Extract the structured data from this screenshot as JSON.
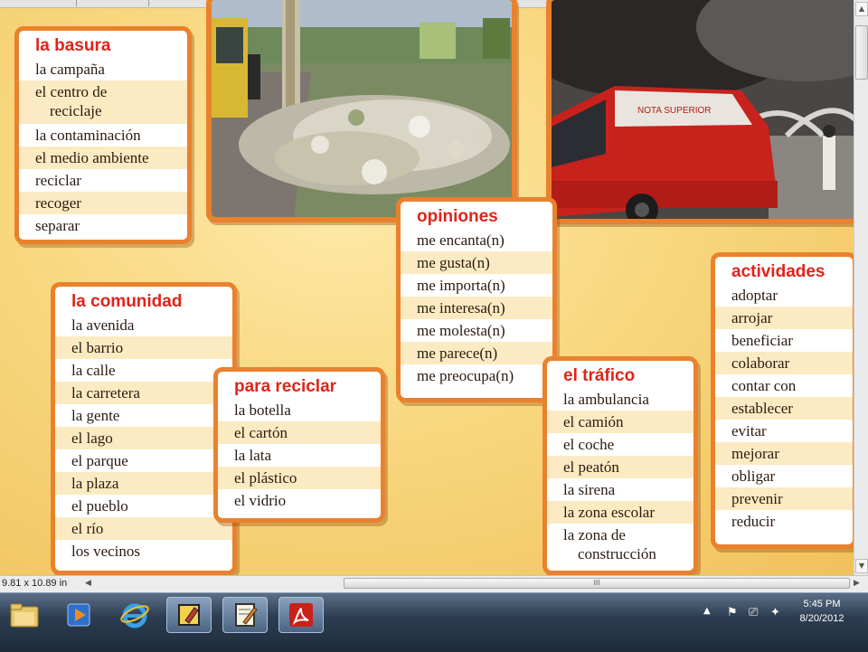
{
  "boxes": {
    "basura": {
      "title": "la basura",
      "items": [
        "la campaña",
        "el centro de",
        "reciclaje",
        "la contaminación",
        "el medio ambiente",
        "reciclar",
        "recoger",
        "separar"
      ]
    },
    "comunidad": {
      "title": "la comunidad",
      "items": [
        "la avenida",
        "el barrio",
        "la calle",
        "la carretera",
        "la gente",
        "el lago",
        "el parque",
        "la plaza",
        "el pueblo",
        "el río",
        "los vecinos"
      ]
    },
    "reciclar": {
      "title": "para reciclar",
      "items": [
        "la botella",
        "el cartón",
        "la lata",
        "el plástico",
        "el vidrio"
      ]
    },
    "opiniones": {
      "title": "opiniones",
      "items": [
        "me encanta(n)",
        "me gusta(n)",
        "me importa(n)",
        "me interesa(n)",
        "me molesta(n)",
        "me parece(n)",
        "me preocupa(n)"
      ]
    },
    "trafico": {
      "title": "el tráfico",
      "items": [
        "la ambulancia",
        "el camión",
        "el coche",
        "el peatón",
        "la sirena",
        "la zona escolar",
        "la zona de",
        "construcción"
      ]
    },
    "actividades": {
      "title": "actividades",
      "items": [
        "adoptar",
        "arrojar",
        "beneficiar",
        "colaborar",
        "contar con",
        "establecer",
        "evitar",
        "mejorar",
        "obligar",
        "prevenir",
        "reducir"
      ]
    }
  },
  "photos": {
    "ambulance_text": "NOTA SUPERIOR"
  },
  "statusbar": {
    "dimensions": "9.81 x 10.89 in",
    "grip": "III"
  },
  "taskbar": {
    "icons": [
      "folder-icon",
      "media-player-icon",
      "internet-explorer-icon",
      "app-icon",
      "notepad-icon",
      "pdf-reader-icon"
    ],
    "time": "5:45 PM",
    "date": "8/20/2012"
  },
  "colors": {
    "accent": "#e9812d",
    "title_red": "#e2231a",
    "stripe": "#fcebc2",
    "background": "#f8d77f"
  }
}
